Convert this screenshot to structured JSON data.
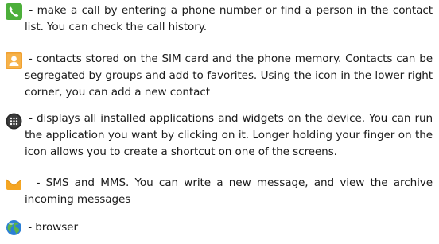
{
  "entries": [
    {
      "icon": "phone-icon",
      "lead": " - ",
      "text": "make a call by entering a phone number or find a person in the contact list. You can check the call history."
    },
    {
      "icon": "contacts-icon",
      "lead": " - ",
      "text": "contacts stored on the SIM card and the phone memory. Contacts can be segregated by groups and add to favorites. Using the icon in the lower right corner, you can add a new contact"
    },
    {
      "icon": "apps-launcher-icon",
      "lead": " - ",
      "text": "displays all installed applications and widgets on the device. You can run the application you want by clicking on it. Longer holding your finger on the icon allows you to create a shortcut on one of the screens."
    },
    {
      "icon": "messaging-icon",
      "lead": "  - ",
      "text": "SMS and MMS. You can write a new message, and view the archive incoming messages"
    },
    {
      "icon": "browser-icon",
      "lead": " - ",
      "text": "browser"
    }
  ],
  "colors": {
    "phone_green": "#4caf3a",
    "contacts_orange": "#f0a030",
    "apps_dark": "#2a2a2a",
    "messaging_orange": "#f5a623",
    "browser_blue": "#2b7fd6",
    "browser_green": "#5bb44a",
    "text": "#1a1a1a"
  }
}
